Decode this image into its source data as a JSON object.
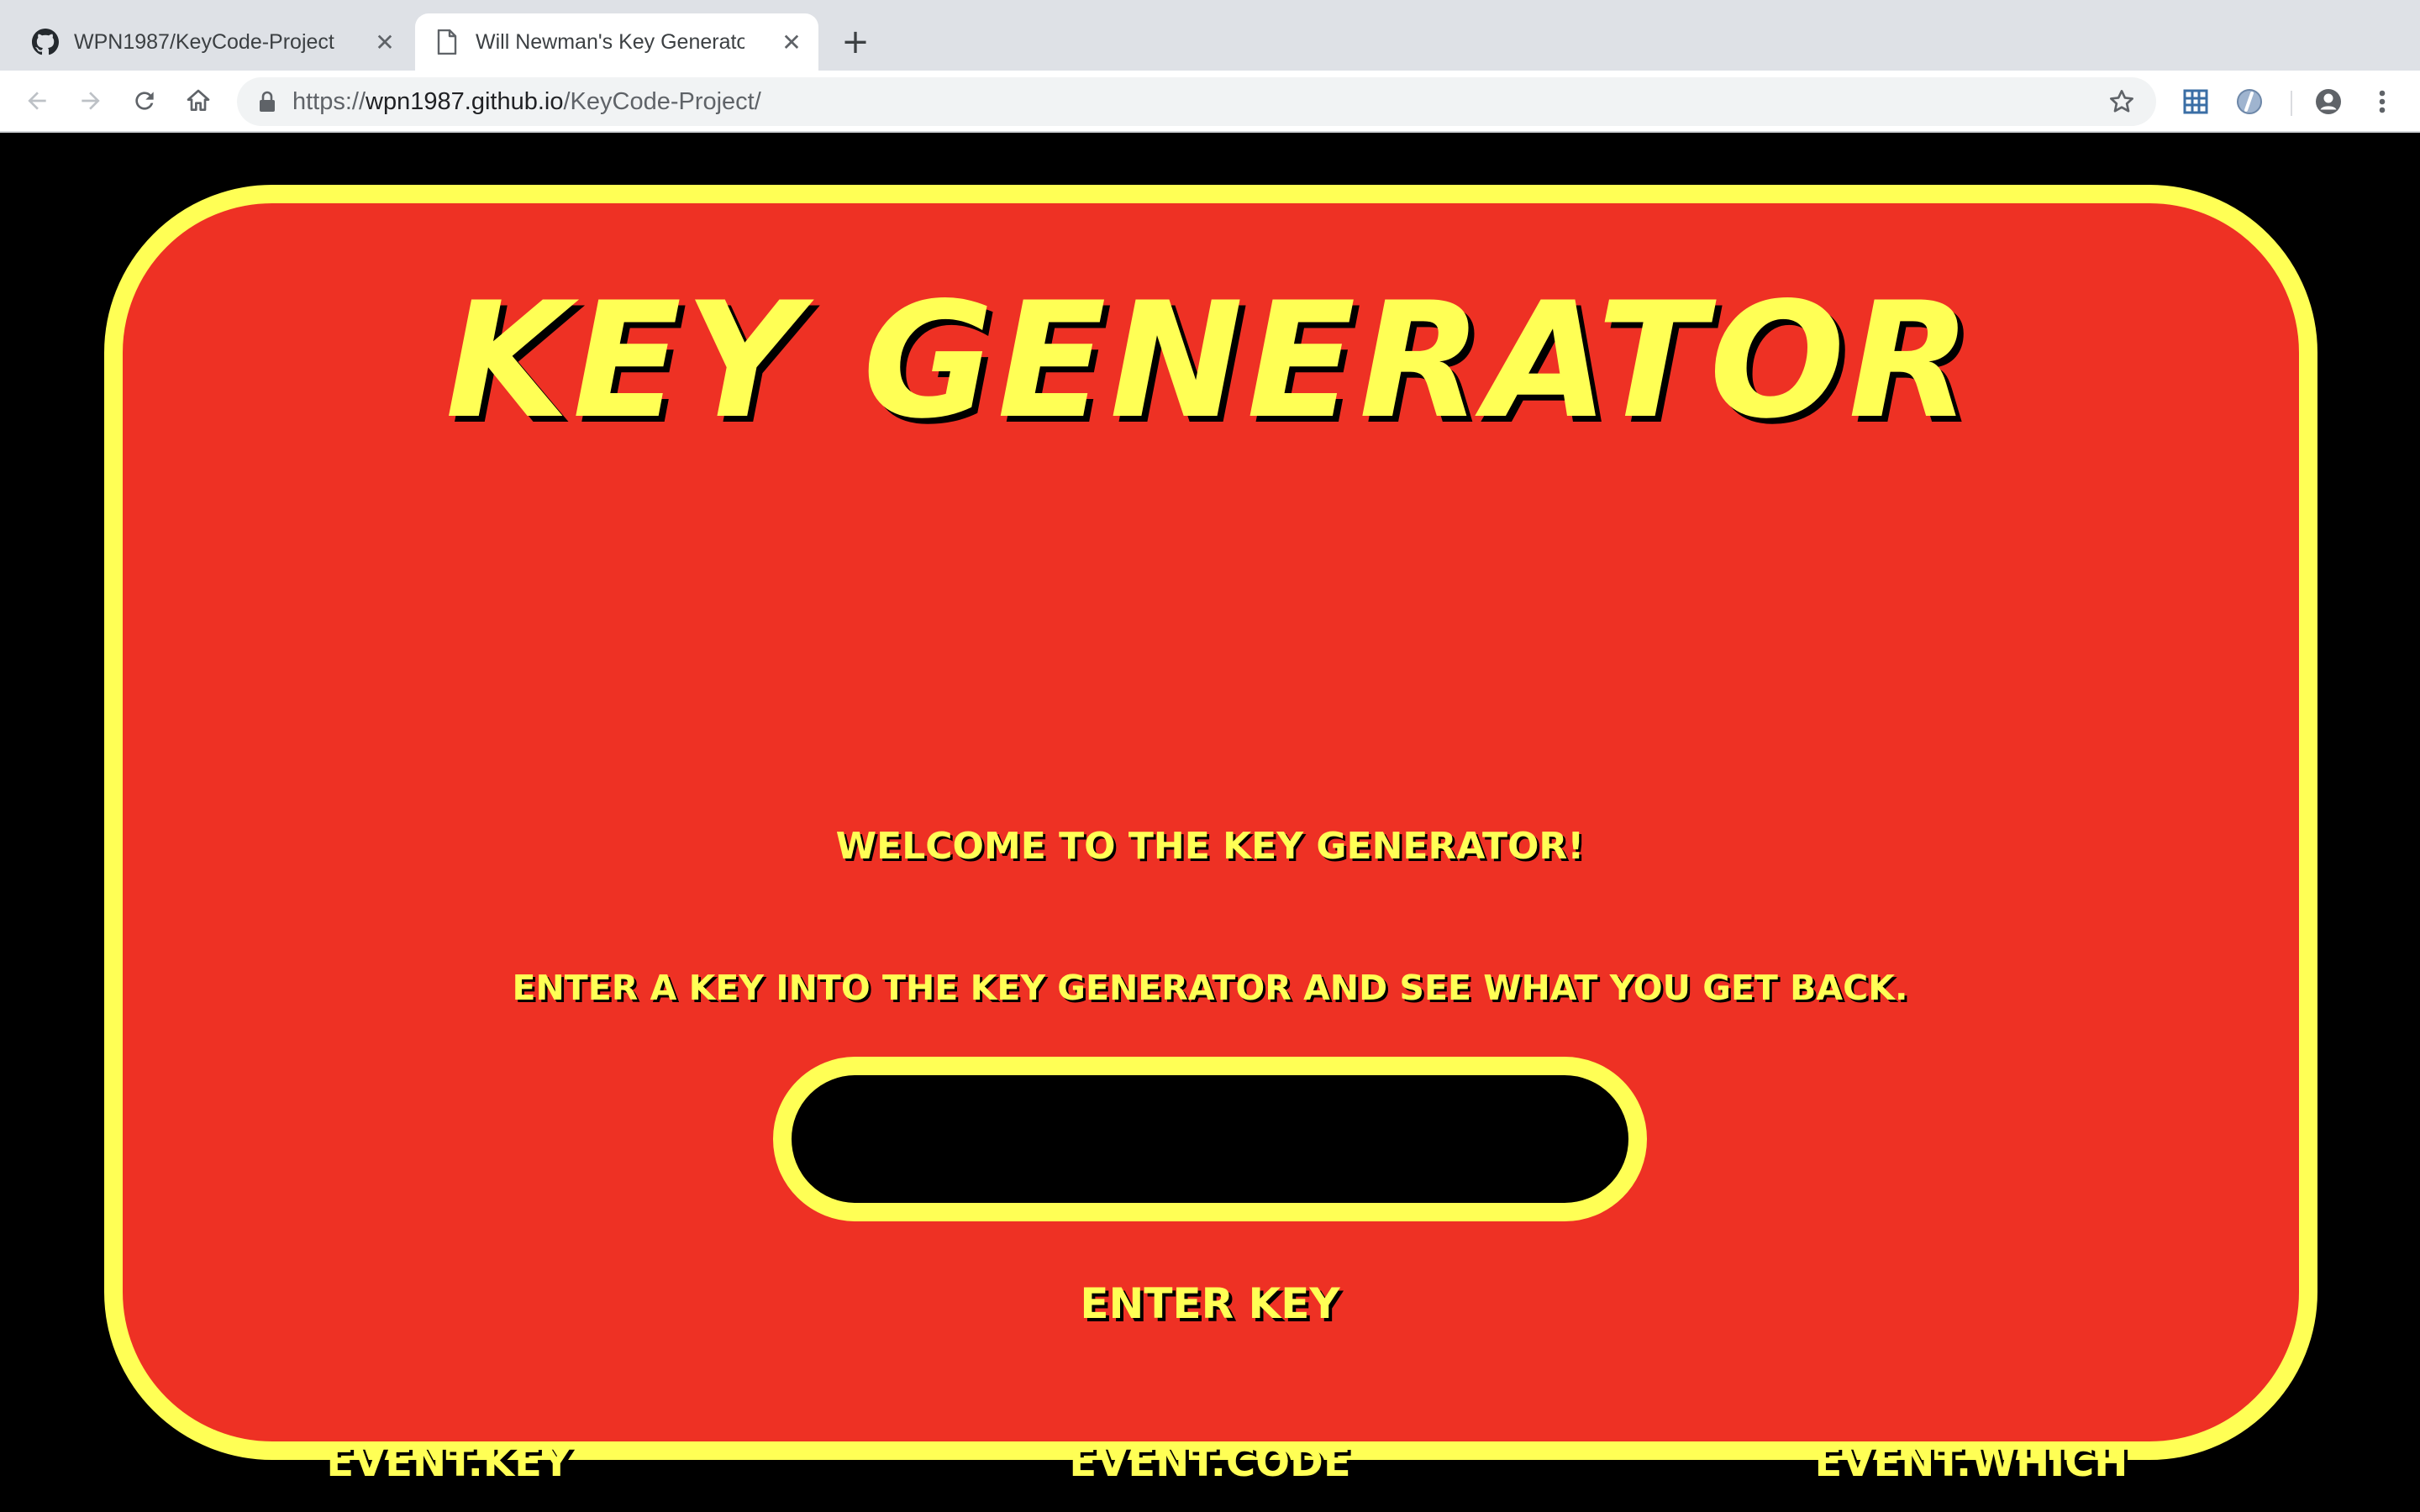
{
  "browser": {
    "tabs": [
      {
        "title": "WPN1987/KeyCode-Project",
        "icon": "github-icon",
        "active": false
      },
      {
        "title": "Will Newman's Key Generator",
        "icon": "document-icon",
        "active": true
      }
    ],
    "close_glyph": "✕",
    "new_tab_glyph": "+",
    "address": {
      "scheme": "https://",
      "host": "wpn1987.github.io",
      "path": "/KeyCode-Project/"
    }
  },
  "page": {
    "title": "KEY GENERATOR",
    "welcome": "WELCOME TO THE KEY GENERATOR!",
    "instructions": "ENTER A KEY INTO THE KEY GENERATOR AND SEE WHAT YOU GET BACK.",
    "input_value": "",
    "enter_button": "ENTER KEY",
    "results": {
      "key_label": "EVENT.KEY",
      "code_label": "EVENT.CODE",
      "which_label": "EVENT.WHICH"
    }
  },
  "colors": {
    "panel_bg": "#ee3124",
    "accent_yellow": "#ffff55",
    "page_bg": "#000000"
  }
}
